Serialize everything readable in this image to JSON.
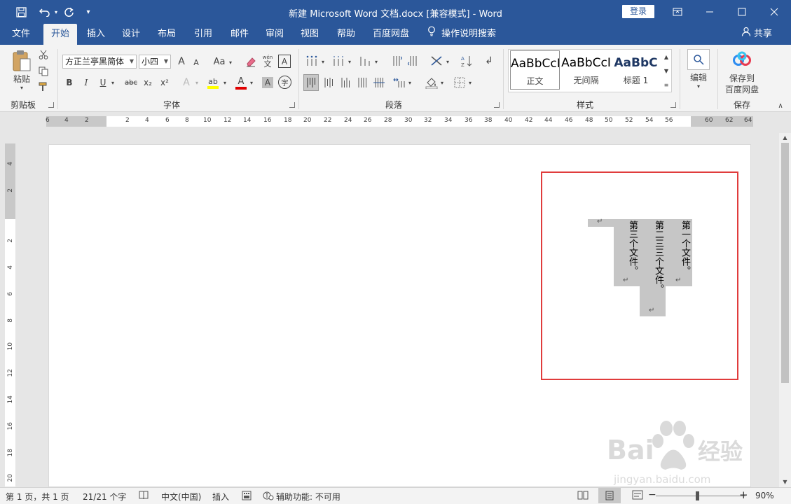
{
  "window": {
    "title": "新建 Microsoft Word 文档.docx [兼容模式]  -  Word",
    "login_label": "登录"
  },
  "tabs": [
    "文件",
    "开始",
    "插入",
    "设计",
    "布局",
    "引用",
    "邮件",
    "审阅",
    "视图",
    "帮助",
    "百度网盘"
  ],
  "tell_me": "操作说明搜索",
  "share_label": "共享",
  "ribbon": {
    "clipboard": {
      "paste_label": "粘贴",
      "group_label": "剪贴板"
    },
    "font": {
      "font_name": "方正兰亭黑简体",
      "font_size": "小四",
      "group_label": "字体",
      "wen_glyph": "wén",
      "wen_char": "文",
      "grow_glyph": "A",
      "shrink_glyph": "A",
      "case_glyph": "Aa",
      "frame_glyph": "A",
      "effects_glyph": "A",
      "highlight_glyph": "ab",
      "color_glyph": "A",
      "shade_glyph": "A",
      "enclose_glyph": "字",
      "bold": "B",
      "italic": "I",
      "underline": "U",
      "strike": "abc",
      "sub": "x₂",
      "sup": "x²"
    },
    "paragraph": {
      "group_label": "段落"
    },
    "styles": {
      "group_label": "样式",
      "items": [
        {
          "preview": "AaBbCcI",
          "name": "正文"
        },
        {
          "preview": "AaBbCcI",
          "name": "无间隔"
        },
        {
          "preview": "AaBbC",
          "name": "标题 1"
        }
      ]
    },
    "editing": {
      "label": "编辑"
    },
    "save": {
      "label_line1": "保存到",
      "label_line2": "百度网盘",
      "group_label": "保存"
    }
  },
  "ruler": {
    "h_left": [
      "6",
      "4",
      "2"
    ],
    "h_main": [
      "2",
      "4",
      "6",
      "8",
      "10",
      "12",
      "14",
      "16",
      "18",
      "20",
      "22",
      "24",
      "26",
      "28",
      "30",
      "32",
      "34",
      "36",
      "38",
      "40",
      "42",
      "44",
      "46",
      "48",
      "50",
      "52",
      "54",
      "56"
    ],
    "h_right": [
      "60",
      "62",
      "64"
    ],
    "v_top": [
      "4",
      "2"
    ],
    "v_main": [
      "2",
      "4",
      "6",
      "8",
      "10",
      "12",
      "14",
      "16",
      "18",
      "20"
    ]
  },
  "document": {
    "columns": [
      {
        "text": "第一个文件。"
      },
      {
        "text": "第二三三个文件。"
      },
      {
        "text": "第三个文件。"
      }
    ],
    "para_mark": "↵"
  },
  "status": {
    "page": "第 1 页，共 1 页",
    "words": "21/21 个字",
    "language": "中文(中国)",
    "mode": "插入",
    "accessibility": "辅助功能: 不可用",
    "zoom_minus": "−",
    "zoom_plus": "+",
    "zoom_level": "90%"
  },
  "watermark": {
    "brand": "Bai",
    "brand2": "经验",
    "url": "jingyan.baidu.com"
  },
  "colors": {
    "accent": "#2b579a",
    "highlight_box": "#e03c3c",
    "column_bg": "#c6c6c6"
  }
}
